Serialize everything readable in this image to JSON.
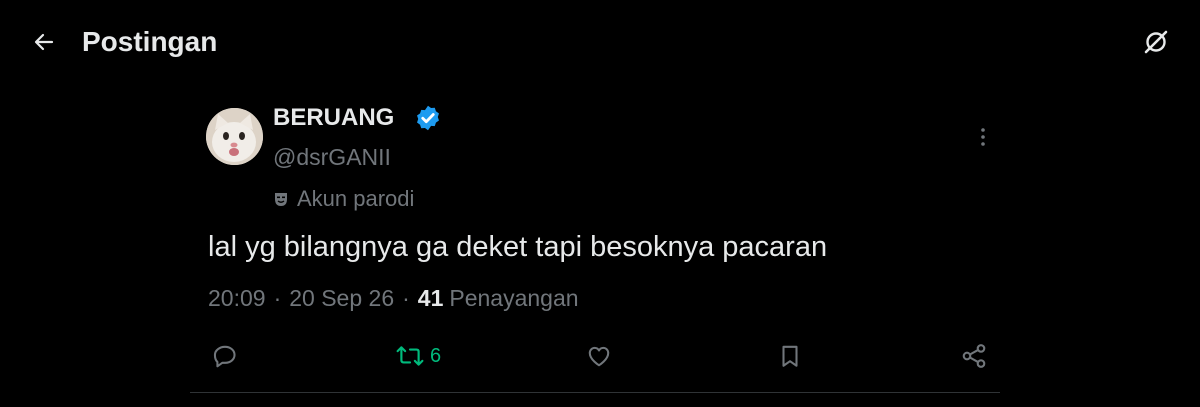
{
  "header": {
    "title": "Postingan"
  },
  "tweet": {
    "display_name": "BERUANG",
    "handle": "@dsrGANII",
    "verified": true,
    "parody_label": "Akun parodi",
    "text": "lal yg bilangnya ga deket tapi besoknya pacaran",
    "time": "20:09",
    "date": "20 Sep 26",
    "views_count": "41",
    "views_label": "Penayangan",
    "separator": "·"
  },
  "actions": {
    "repost_count": "6"
  },
  "colors": {
    "background": "#000000",
    "text_primary": "#e7e9ea",
    "text_secondary": "#71767b",
    "verified_blue": "#1d9bf0",
    "repost_green": "#00ba7c",
    "divider": "#2f3336"
  },
  "icons": [
    "back-arrow-icon",
    "grok-icon",
    "verified-badge-icon",
    "more-options-icon",
    "parody-mask-icon",
    "reply-icon",
    "repost-icon",
    "like-icon",
    "bookmark-icon",
    "share-icon"
  ]
}
